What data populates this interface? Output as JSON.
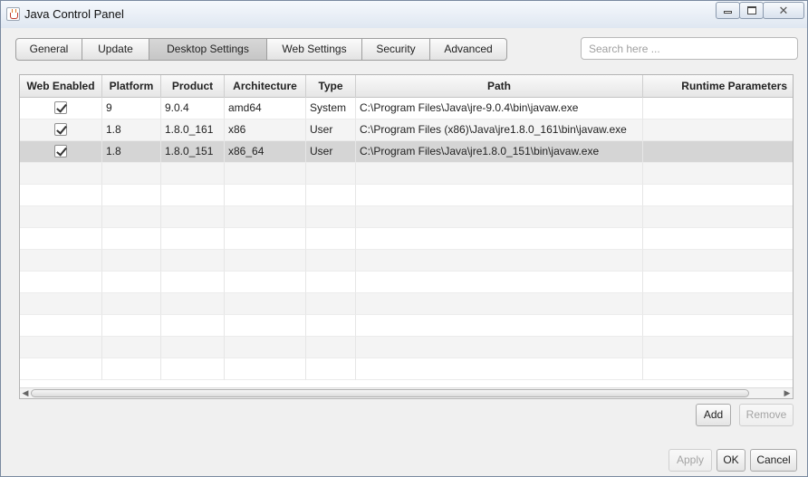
{
  "window": {
    "title": "Java Control Panel"
  },
  "tabs": [
    {
      "label": "General"
    },
    {
      "label": "Update"
    },
    {
      "label": "Desktop Settings"
    },
    {
      "label": "Web Settings"
    },
    {
      "label": "Security"
    },
    {
      "label": "Advanced"
    }
  ],
  "active_tab": "Desktop Settings",
  "search": {
    "placeholder": "Search here ...",
    "value": ""
  },
  "table": {
    "columns": [
      "Web Enabled",
      "Platform",
      "Product",
      "Architecture",
      "Type",
      "Path",
      "Runtime Parameters"
    ],
    "rows": [
      {
        "web_enabled": true,
        "platform": "9",
        "product": "9.0.4",
        "architecture": "amd64",
        "type": "System",
        "path": "C:\\Program Files\\Java\\jre-9.0.4\\bin\\javaw.exe",
        "runtime_parameters": ""
      },
      {
        "web_enabled": true,
        "platform": "1.8",
        "product": "1.8.0_161",
        "architecture": "x86",
        "type": "User",
        "path": "C:\\Program Files (x86)\\Java\\jre1.8.0_161\\bin\\javaw.exe",
        "runtime_parameters": ""
      },
      {
        "web_enabled": true,
        "platform": "1.8",
        "product": "1.8.0_151",
        "architecture": "x86_64",
        "type": "User",
        "path": "C:\\Program Files\\Java\\jre1.8.0_151\\bin\\javaw.exe",
        "runtime_parameters": ""
      }
    ],
    "selected_row": 2
  },
  "buttons": {
    "add": "Add",
    "remove": "Remove",
    "apply": "Apply",
    "ok": "OK",
    "cancel": "Cancel"
  },
  "colors": {
    "selected_row": "#d5d5d5",
    "active_tab": "#cbcbcb",
    "disabled_text": "#a4a4a4"
  }
}
